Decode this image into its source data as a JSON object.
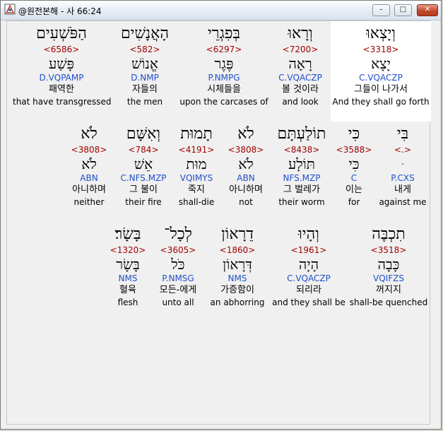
{
  "window": {
    "title": "@원전본해 - 사 66:24",
    "buttons": {
      "minimize": "–",
      "maximize": "□",
      "close": "✕"
    },
    "icon": "app-icon"
  },
  "rows": [
    {
      "words": [
        {
          "hebrew": "וְיָצְאוּ",
          "strong": "<3318>",
          "lemma": "יָצָא",
          "morph": "C.VQACZP",
          "korean": "그들이 나가서",
          "english": "And they shall go forth",
          "highlighted": true
        },
        {
          "hebrew": "וְרָאוּ",
          "strong": "<7200>",
          "lemma": "רָאָה",
          "morph": "C.VQACZP",
          "korean": "볼 것이라",
          "english": "and look"
        },
        {
          "hebrew": "בְּפִגְרֵי",
          "strong": "<6297>",
          "lemma": "פֶּגֶר",
          "morph": "P.NMPG",
          "korean": "시체들을",
          "english": "upon the carcases of"
        },
        {
          "hebrew": "הָאֲנָשִׁים",
          "strong": "<582>",
          "lemma": "אֱנוֹשׁ",
          "morph": "D.NMP",
          "korean": "자들의",
          "english": "the men"
        },
        {
          "hebrew": "הַפֹּשְׁעִים",
          "strong": "<6586>",
          "lemma": "פָּשַׁע",
          "morph": "D.VQPAMP",
          "korean": "패역한",
          "english": "that have transgressed"
        }
      ]
    },
    {
      "words": [
        {
          "hebrew": "בִּי",
          "strong": "<.>",
          "lemma": "ּ",
          "morph": "P.CXS",
          "korean": "내게",
          "english": "against me"
        },
        {
          "hebrew": "כִּי",
          "strong": "<3588>",
          "lemma": "כִּי",
          "morph": "C",
          "korean": "이는",
          "english": "for"
        },
        {
          "hebrew": "תוֹלַעְתָּם",
          "strong": "<8438>",
          "lemma": "תּוֹלָע",
          "morph": "NFS.MZP",
          "korean": "그 벌레가",
          "english": "their worm"
        },
        {
          "hebrew": "לֹא",
          "strong": "<3808>",
          "lemma": "לֹא",
          "morph": "ABN",
          "korean": "아니하며",
          "english": "not"
        },
        {
          "hebrew": "תָמוּת",
          "strong": "<4191>",
          "lemma": "מוּת",
          "morph": "VQIMYS",
          "korean": "죽지",
          "english": "shall-die"
        },
        {
          "hebrew": "וְאִשָּׁם",
          "strong": "<784>",
          "lemma": "אֵשׁ",
          "morph": "C.NFS.MZP",
          "korean": "그 불이",
          "english": "their fire"
        },
        {
          "hebrew": "לֹא",
          "strong": "<3808>",
          "lemma": "לֹא",
          "morph": "ABN",
          "korean": "아니하며",
          "english": "neither"
        }
      ]
    },
    {
      "words": [
        {
          "hebrew": "תִכְבֶּה",
          "strong": "<3518>",
          "lemma": "כָּבָה",
          "morph": "VQIFZS",
          "korean": "꺼지지",
          "english": "shall-be quenched"
        },
        {
          "hebrew": "וְהָיוּ",
          "strong": "<1961>",
          "lemma": "הָיָה",
          "morph": "C.VQACZP",
          "korean": "되리라",
          "english": "and they shall be"
        },
        {
          "hebrew": "דֵרָאוֹן",
          "strong": "<1860>",
          "lemma": "דְּרָאוֹן",
          "morph": "NMS",
          "korean": "가증함이",
          "english": "an abhorring"
        },
        {
          "hebrew": "לְכָל־",
          "strong": "<3605>",
          "lemma": "כֹּל",
          "morph": "P.NMSG",
          "korean": "모든-에게",
          "english": "unto all"
        },
        {
          "hebrew": "בָּשָׂר׃",
          "strong": "<1320>",
          "lemma": "בָּשָׂר",
          "morph": "NMS",
          "korean": "혈육",
          "english": "flesh"
        }
      ]
    }
  ]
}
